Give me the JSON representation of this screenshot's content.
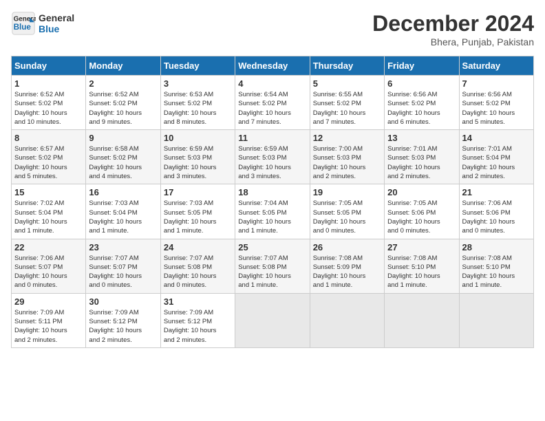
{
  "header": {
    "logo_line1": "General",
    "logo_line2": "Blue",
    "title": "December 2024",
    "subtitle": "Bhera, Punjab, Pakistan"
  },
  "calendar": {
    "days_of_week": [
      "Sunday",
      "Monday",
      "Tuesday",
      "Wednesday",
      "Thursday",
      "Friday",
      "Saturday"
    ],
    "weeks": [
      [
        {
          "day": "",
          "info": ""
        },
        {
          "day": "",
          "info": ""
        },
        {
          "day": "",
          "info": ""
        },
        {
          "day": "",
          "info": ""
        },
        {
          "day": "",
          "info": ""
        },
        {
          "day": "",
          "info": ""
        },
        {
          "day": "1",
          "info": "Sunrise: 6:52 AM\nSunset: 5:02 PM\nDaylight: 10 hours\nand 10 minutes."
        }
      ],
      [
        {
          "day": "1",
          "info": "Sunrise: 6:52 AM\nSunset: 5:02 PM\nDaylight: 10 hours\nand 10 minutes."
        },
        {
          "day": "2",
          "info": "Sunrise: 6:52 AM\nSunset: 5:02 PM\nDaylight: 10 hours\nand 9 minutes."
        },
        {
          "day": "3",
          "info": "Sunrise: 6:53 AM\nSunset: 5:02 PM\nDaylight: 10 hours\nand 8 minutes."
        },
        {
          "day": "4",
          "info": "Sunrise: 6:54 AM\nSunset: 5:02 PM\nDaylight: 10 hours\nand 7 minutes."
        },
        {
          "day": "5",
          "info": "Sunrise: 6:55 AM\nSunset: 5:02 PM\nDaylight: 10 hours\nand 7 minutes."
        },
        {
          "day": "6",
          "info": "Sunrise: 6:56 AM\nSunset: 5:02 PM\nDaylight: 10 hours\nand 6 minutes."
        },
        {
          "day": "7",
          "info": "Sunrise: 6:56 AM\nSunset: 5:02 PM\nDaylight: 10 hours\nand 5 minutes."
        }
      ],
      [
        {
          "day": "8",
          "info": "Sunrise: 6:57 AM\nSunset: 5:02 PM\nDaylight: 10 hours\nand 5 minutes."
        },
        {
          "day": "9",
          "info": "Sunrise: 6:58 AM\nSunset: 5:02 PM\nDaylight: 10 hours\nand 4 minutes."
        },
        {
          "day": "10",
          "info": "Sunrise: 6:59 AM\nSunset: 5:03 PM\nDaylight: 10 hours\nand 3 minutes."
        },
        {
          "day": "11",
          "info": "Sunrise: 6:59 AM\nSunset: 5:03 PM\nDaylight: 10 hours\nand 3 minutes."
        },
        {
          "day": "12",
          "info": "Sunrise: 7:00 AM\nSunset: 5:03 PM\nDaylight: 10 hours\nand 2 minutes."
        },
        {
          "day": "13",
          "info": "Sunrise: 7:01 AM\nSunset: 5:03 PM\nDaylight: 10 hours\nand 2 minutes."
        },
        {
          "day": "14",
          "info": "Sunrise: 7:01 AM\nSunset: 5:04 PM\nDaylight: 10 hours\nand 2 minutes."
        }
      ],
      [
        {
          "day": "15",
          "info": "Sunrise: 7:02 AM\nSunset: 5:04 PM\nDaylight: 10 hours\nand 1 minute."
        },
        {
          "day": "16",
          "info": "Sunrise: 7:03 AM\nSunset: 5:04 PM\nDaylight: 10 hours\nand 1 minute."
        },
        {
          "day": "17",
          "info": "Sunrise: 7:03 AM\nSunset: 5:05 PM\nDaylight: 10 hours\nand 1 minute."
        },
        {
          "day": "18",
          "info": "Sunrise: 7:04 AM\nSunset: 5:05 PM\nDaylight: 10 hours\nand 1 minute."
        },
        {
          "day": "19",
          "info": "Sunrise: 7:05 AM\nSunset: 5:05 PM\nDaylight: 10 hours\nand 0 minutes."
        },
        {
          "day": "20",
          "info": "Sunrise: 7:05 AM\nSunset: 5:06 PM\nDaylight: 10 hours\nand 0 minutes."
        },
        {
          "day": "21",
          "info": "Sunrise: 7:06 AM\nSunset: 5:06 PM\nDaylight: 10 hours\nand 0 minutes."
        }
      ],
      [
        {
          "day": "22",
          "info": "Sunrise: 7:06 AM\nSunset: 5:07 PM\nDaylight: 10 hours\nand 0 minutes."
        },
        {
          "day": "23",
          "info": "Sunrise: 7:07 AM\nSunset: 5:07 PM\nDaylight: 10 hours\nand 0 minutes."
        },
        {
          "day": "24",
          "info": "Sunrise: 7:07 AM\nSunset: 5:08 PM\nDaylight: 10 hours\nand 0 minutes."
        },
        {
          "day": "25",
          "info": "Sunrise: 7:07 AM\nSunset: 5:08 PM\nDaylight: 10 hours\nand 1 minute."
        },
        {
          "day": "26",
          "info": "Sunrise: 7:08 AM\nSunset: 5:09 PM\nDaylight: 10 hours\nand 1 minute."
        },
        {
          "day": "27",
          "info": "Sunrise: 7:08 AM\nSunset: 5:10 PM\nDaylight: 10 hours\nand 1 minute."
        },
        {
          "day": "28",
          "info": "Sunrise: 7:08 AM\nSunset: 5:10 PM\nDaylight: 10 hours\nand 1 minute."
        }
      ],
      [
        {
          "day": "29",
          "info": "Sunrise: 7:09 AM\nSunset: 5:11 PM\nDaylight: 10 hours\nand 2 minutes."
        },
        {
          "day": "30",
          "info": "Sunrise: 7:09 AM\nSunset: 5:12 PM\nDaylight: 10 hours\nand 2 minutes."
        },
        {
          "day": "31",
          "info": "Sunrise: 7:09 AM\nSunset: 5:12 PM\nDaylight: 10 hours\nand 2 minutes."
        },
        {
          "day": "",
          "info": ""
        },
        {
          "day": "",
          "info": ""
        },
        {
          "day": "",
          "info": ""
        },
        {
          "day": "",
          "info": ""
        }
      ]
    ]
  }
}
